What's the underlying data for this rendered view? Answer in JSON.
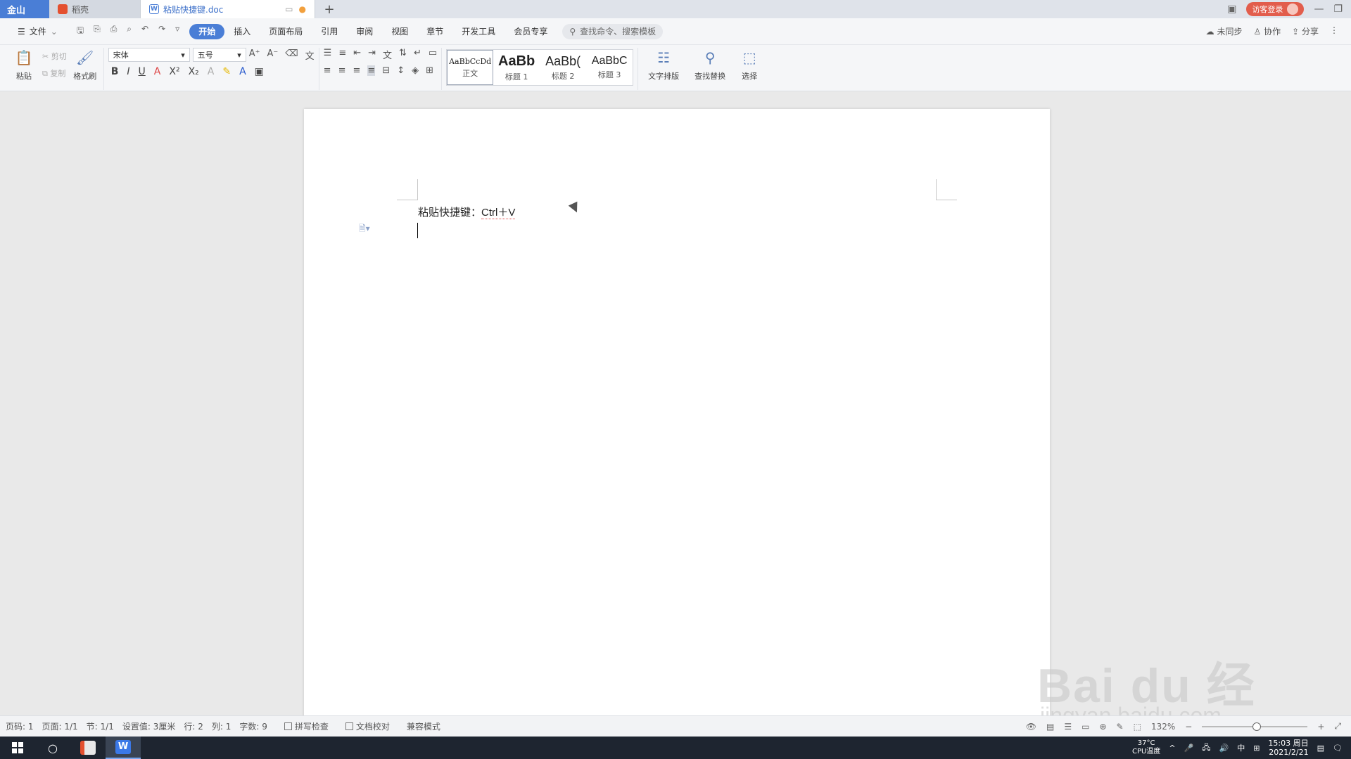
{
  "titlebar": {
    "home_label": "金山",
    "tabs": [
      {
        "label": "稻壳",
        "icon": "daoke-logo-icon"
      },
      {
        "label": "粘贴快捷键.doc",
        "icon": "wps-doc-icon"
      }
    ],
    "new_tab": "+",
    "login_label": "访客登录",
    "window_controls": {
      "minimize": "—",
      "restore": "❐"
    }
  },
  "menubar": {
    "file_label": "文件",
    "items": [
      "开始",
      "插入",
      "页面布局",
      "引用",
      "审阅",
      "视图",
      "章节",
      "开发工具",
      "会员专享"
    ],
    "active_index": 0,
    "search_label": "查找命令、搜索模板",
    "right": [
      "未同步",
      "协作",
      "分享"
    ]
  },
  "ribbon": {
    "paste_label": "粘贴",
    "cut_label": "剪切",
    "copy_label": "复制",
    "format_painter_label": "格式刷",
    "font_name": "宋体",
    "font_size": "五号",
    "bold": "B",
    "italic": "I",
    "underline": "U",
    "styles": [
      {
        "sample": "AaBbCcDd",
        "label": "正文"
      },
      {
        "sample": "AaBb",
        "label": "标题 1"
      },
      {
        "sample": "AaBb(",
        "label": "标题 2"
      },
      {
        "sample": "AaBbC",
        "label": "标题 3"
      }
    ],
    "text_layout_label": "文字排版",
    "find_replace_label": "查找替换",
    "select_label": "选择"
  },
  "document": {
    "line1_text": "粘贴快捷键：",
    "line1_shortcut": "Ctrl＋V"
  },
  "watermark": {
    "main": "Bai du 经验",
    "sub": "jingyan.baidu.com"
  },
  "statusbar": {
    "page_num": "页码: 1",
    "pages": "页面: 1/1",
    "section": "节: 1/1",
    "setting": "设置值: 3厘米",
    "row": "行: 2",
    "col": "列: 1",
    "word_count": "字数: 9",
    "spell_check": "拼写检查",
    "doc_proof": "文档校对",
    "compat_mode": "兼容模式",
    "zoom": "132%"
  },
  "taskbar": {
    "temp": "37°C",
    "temp_sub": "CPU温度",
    "ime": "中",
    "time": "15:03 周日",
    "date": "2021/2/21"
  },
  "colors": {
    "accent": "#4a7ed6",
    "login": "#e25d4c",
    "taskbar": "#1e2530"
  }
}
